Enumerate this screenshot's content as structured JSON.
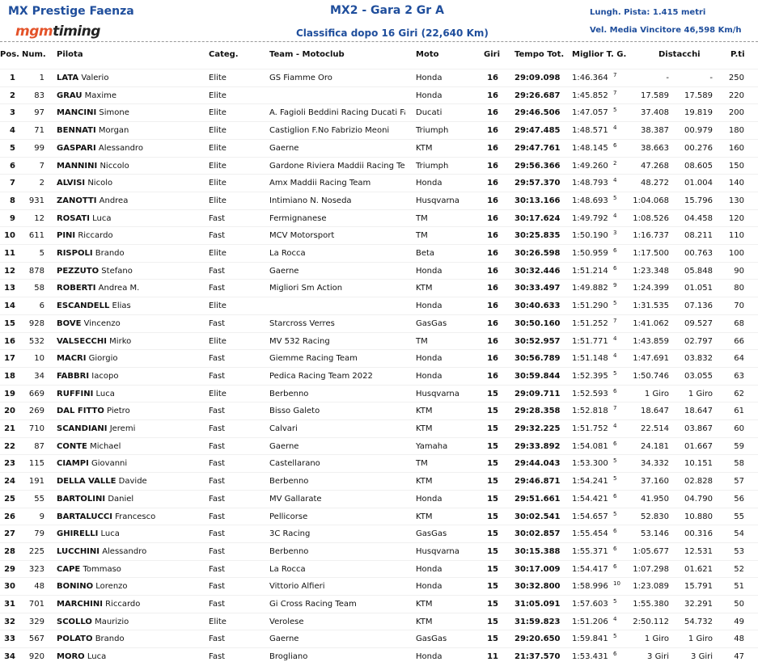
{
  "header": {
    "event": "MX Prestige Faenza",
    "logo_a": "mgm",
    "logo_b": "timing",
    "race": "MX2 - Gara 2 Gr A",
    "classification": "Classifica dopo 16 Giri (22,640 Km)",
    "track_length": "Lungh. Pista: 1.415 metri",
    "winner_speed": "Vel. Media Vincitore 46,598 Km/h"
  },
  "columns": {
    "pos": "Pos.",
    "num": "Num.",
    "pilota": "Pilota",
    "categ": "Categ.",
    "team": "Team - Motoclub",
    "moto": "Moto",
    "giri": "Giri",
    "tempo": "Tempo Tot.",
    "miglior": "Miglior T. G.",
    "distacchi": "Distacchi",
    "pti": "P.ti"
  },
  "rows": [
    {
      "pos": "1",
      "num": "1",
      "last": "LATA",
      "first": "Valerio",
      "cat": "Elite",
      "team": "GS Fiamme Oro",
      "moto": "Honda",
      "giri": "16",
      "tempo": "29:09.098",
      "best": "1:46.364",
      "lap": "7",
      "d1": "-",
      "d2": "-",
      "pt": "250"
    },
    {
      "pos": "2",
      "num": "83",
      "last": "GRAU",
      "first": "Maxime",
      "cat": "Elite",
      "team": "",
      "moto": "Honda",
      "giri": "16",
      "tempo": "29:26.687",
      "best": "1:45.852",
      "lap": "7",
      "d1": "17.589",
      "d2": "17.589",
      "pt": "220"
    },
    {
      "pos": "3",
      "num": "97",
      "last": "MANCINI",
      "first": "Simone",
      "cat": "Elite",
      "team": "A. Fagioli Beddini Racing Ducati Fa",
      "moto": "Ducati",
      "giri": "16",
      "tempo": "29:46.506",
      "best": "1:47.057",
      "lap": "5",
      "d1": "37.408",
      "d2": "19.819",
      "pt": "200"
    },
    {
      "pos": "4",
      "num": "71",
      "last": "BENNATI",
      "first": "Morgan",
      "cat": "Elite",
      "team": "Castiglion F.No Fabrizio Meoni",
      "moto": "Triumph",
      "giri": "16",
      "tempo": "29:47.485",
      "best": "1:48.571",
      "lap": "4",
      "d1": "38.387",
      "d2": "00.979",
      "pt": "180"
    },
    {
      "pos": "5",
      "num": "99",
      "last": "GASPARI",
      "first": "Alessandro",
      "cat": "Elite",
      "team": "Gaerne",
      "moto": "KTM",
      "giri": "16",
      "tempo": "29:47.761",
      "best": "1:48.145",
      "lap": "6",
      "d1": "38.663",
      "d2": "00.276",
      "pt": "160"
    },
    {
      "pos": "6",
      "num": "7",
      "last": "MANNINI",
      "first": "Niccolo",
      "cat": "Elite",
      "team": "Gardone Riviera Maddii Racing Te",
      "moto": "Triumph",
      "giri": "16",
      "tempo": "29:56.366",
      "best": "1:49.260",
      "lap": "2",
      "d1": "47.268",
      "d2": "08.605",
      "pt": "150"
    },
    {
      "pos": "7",
      "num": "2",
      "last": "ALVISI",
      "first": "Nicolo",
      "cat": "Elite",
      "team": "Amx Maddii Racing Team",
      "moto": "Honda",
      "giri": "16",
      "tempo": "29:57.370",
      "best": "1:48.793",
      "lap": "4",
      "d1": "48.272",
      "d2": "01.004",
      "pt": "140"
    },
    {
      "pos": "8",
      "num": "931",
      "last": "ZANOTTI",
      "first": "Andrea",
      "cat": "Elite",
      "team": "Intimiano N. Noseda",
      "moto": "Husqvarna",
      "giri": "16",
      "tempo": "30:13.166",
      "best": "1:48.693",
      "lap": "5",
      "d1": "1:04.068",
      "d2": "15.796",
      "pt": "130"
    },
    {
      "pos": "9",
      "num": "12",
      "last": "ROSATI",
      "first": "Luca",
      "cat": "Fast",
      "team": "Fermignanese",
      "moto": "TM",
      "giri": "16",
      "tempo": "30:17.624",
      "best": "1:49.792",
      "lap": "4",
      "d1": "1:08.526",
      "d2": "04.458",
      "pt": "120"
    },
    {
      "pos": "10",
      "num": "611",
      "last": "PINI",
      "first": "Riccardo",
      "cat": "Fast",
      "team": "MCV Motorsport",
      "moto": "TM",
      "giri": "16",
      "tempo": "30:25.835",
      "best": "1:50.190",
      "lap": "3",
      "d1": "1:16.737",
      "d2": "08.211",
      "pt": "110"
    },
    {
      "pos": "11",
      "num": "5",
      "last": "RISPOLI",
      "first": "Brando",
      "cat": "Elite",
      "team": "La Rocca",
      "moto": "Beta",
      "giri": "16",
      "tempo": "30:26.598",
      "best": "1:50.959",
      "lap": "6",
      "d1": "1:17.500",
      "d2": "00.763",
      "pt": "100"
    },
    {
      "pos": "12",
      "num": "878",
      "last": "PEZZUTO",
      "first": "Stefano",
      "cat": "Fast",
      "team": "Gaerne",
      "moto": "Honda",
      "giri": "16",
      "tempo": "30:32.446",
      "best": "1:51.214",
      "lap": "6",
      "d1": "1:23.348",
      "d2": "05.848",
      "pt": "90"
    },
    {
      "pos": "13",
      "num": "58",
      "last": "ROBERTI",
      "first": "Andrea M.",
      "cat": "Fast",
      "team": "Migliori Sm Action",
      "moto": "KTM",
      "giri": "16",
      "tempo": "30:33.497",
      "best": "1:49.882",
      "lap": "9",
      "d1": "1:24.399",
      "d2": "01.051",
      "pt": "80"
    },
    {
      "pos": "14",
      "num": "6",
      "last": "ESCANDELL",
      "first": "Elias",
      "cat": "Elite",
      "team": "",
      "moto": "Honda",
      "giri": "16",
      "tempo": "30:40.633",
      "best": "1:51.290",
      "lap": "5",
      "d1": "1:31.535",
      "d2": "07.136",
      "pt": "70"
    },
    {
      "pos": "15",
      "num": "928",
      "last": "BOVE",
      "first": "Vincenzo",
      "cat": "Fast",
      "team": "Starcross Verres",
      "moto": "GasGas",
      "giri": "16",
      "tempo": "30:50.160",
      "best": "1:51.252",
      "lap": "7",
      "d1": "1:41.062",
      "d2": "09.527",
      "pt": "68"
    },
    {
      "pos": "16",
      "num": "532",
      "last": "VALSECCHI",
      "first": "Mirko",
      "cat": "Elite",
      "team": "MV 532 Racing",
      "moto": "TM",
      "giri": "16",
      "tempo": "30:52.957",
      "best": "1:51.771",
      "lap": "4",
      "d1": "1:43.859",
      "d2": "02.797",
      "pt": "66"
    },
    {
      "pos": "17",
      "num": "10",
      "last": "MACRI",
      "first": "Giorgio",
      "cat": "Fast",
      "team": "Giemme Racing Team",
      "moto": "Honda",
      "giri": "16",
      "tempo": "30:56.789",
      "best": "1:51.148",
      "lap": "4",
      "d1": "1:47.691",
      "d2": "03.832",
      "pt": "64"
    },
    {
      "pos": "18",
      "num": "34",
      "last": "FABBRI",
      "first": "Iacopo",
      "cat": "Fast",
      "team": "Pedica Racing Team 2022",
      "moto": "Honda",
      "giri": "16",
      "tempo": "30:59.844",
      "best": "1:52.395",
      "lap": "5",
      "d1": "1:50.746",
      "d2": "03.055",
      "pt": "63"
    },
    {
      "pos": "19",
      "num": "669",
      "last": "RUFFINI",
      "first": "Luca",
      "cat": "Elite",
      "team": "Berbenno",
      "moto": "Husqvarna",
      "giri": "15",
      "tempo": "29:09.711",
      "best": "1:52.593",
      "lap": "6",
      "d1": "1 Giro",
      "d2": "1 Giro",
      "pt": "62"
    },
    {
      "pos": "20",
      "num": "269",
      "last": "DAL FITTO",
      "first": "Pietro",
      "cat": "Fast",
      "team": "Bisso Galeto",
      "moto": "KTM",
      "giri": "15",
      "tempo": "29:28.358",
      "best": "1:52.818",
      "lap": "7",
      "d1": "18.647",
      "d2": "18.647",
      "pt": "61"
    },
    {
      "pos": "21",
      "num": "710",
      "last": "SCANDIANI",
      "first": "Jeremi",
      "cat": "Fast",
      "team": "Calvari",
      "moto": "KTM",
      "giri": "15",
      "tempo": "29:32.225",
      "best": "1:51.752",
      "lap": "4",
      "d1": "22.514",
      "d2": "03.867",
      "pt": "60"
    },
    {
      "pos": "22",
      "num": "87",
      "last": "CONTE",
      "first": "Michael",
      "cat": "Fast",
      "team": "Gaerne",
      "moto": "Yamaha",
      "giri": "15",
      "tempo": "29:33.892",
      "best": "1:54.081",
      "lap": "6",
      "d1": "24.181",
      "d2": "01.667",
      "pt": "59"
    },
    {
      "pos": "23",
      "num": "115",
      "last": "CIAMPI",
      "first": "Giovanni",
      "cat": "Fast",
      "team": "Castellarano",
      "moto": "TM",
      "giri": "15",
      "tempo": "29:44.043",
      "best": "1:53.300",
      "lap": "5",
      "d1": "34.332",
      "d2": "10.151",
      "pt": "58"
    },
    {
      "pos": "24",
      "num": "191",
      "last": "DELLA VALLE",
      "first": "Davide",
      "cat": "Fast",
      "team": "Berbenno",
      "moto": "KTM",
      "giri": "15",
      "tempo": "29:46.871",
      "best": "1:54.241",
      "lap": "5",
      "d1": "37.160",
      "d2": "02.828",
      "pt": "57"
    },
    {
      "pos": "25",
      "num": "55",
      "last": "BARTOLINI",
      "first": "Daniel",
      "cat": "Fast",
      "team": "MV Gallarate",
      "moto": "Honda",
      "giri": "15",
      "tempo": "29:51.661",
      "best": "1:54.421",
      "lap": "6",
      "d1": "41.950",
      "d2": "04.790",
      "pt": "56"
    },
    {
      "pos": "26",
      "num": "9",
      "last": "BARTALUCCI",
      "first": "Francesco",
      "cat": "Fast",
      "team": "Pellicorse",
      "moto": "KTM",
      "giri": "15",
      "tempo": "30:02.541",
      "best": "1:54.657",
      "lap": "5",
      "d1": "52.830",
      "d2": "10.880",
      "pt": "55"
    },
    {
      "pos": "27",
      "num": "79",
      "last": "GHIRELLI",
      "first": "Luca",
      "cat": "Fast",
      "team": "3C Racing",
      "moto": "GasGas",
      "giri": "15",
      "tempo": "30:02.857",
      "best": "1:55.454",
      "lap": "6",
      "d1": "53.146",
      "d2": "00.316",
      "pt": "54"
    },
    {
      "pos": "28",
      "num": "225",
      "last": "LUCCHINI",
      "first": "Alessandro",
      "cat": "Fast",
      "team": "Berbenno",
      "moto": "Husqvarna",
      "giri": "15",
      "tempo": "30:15.388",
      "best": "1:55.371",
      "lap": "6",
      "d1": "1:05.677",
      "d2": "12.531",
      "pt": "53"
    },
    {
      "pos": "29",
      "num": "323",
      "last": "CAPE",
      "first": "Tommaso",
      "cat": "Fast",
      "team": "La Rocca",
      "moto": "Honda",
      "giri": "15",
      "tempo": "30:17.009",
      "best": "1:54.417",
      "lap": "6",
      "d1": "1:07.298",
      "d2": "01.621",
      "pt": "52"
    },
    {
      "pos": "30",
      "num": "48",
      "last": "BONINO",
      "first": "Lorenzo",
      "cat": "Fast",
      "team": "Vittorio Alfieri",
      "moto": "Honda",
      "giri": "15",
      "tempo": "30:32.800",
      "best": "1:58.996",
      "lap": "10",
      "d1": "1:23.089",
      "d2": "15.791",
      "pt": "51"
    },
    {
      "pos": "31",
      "num": "701",
      "last": "MARCHINI",
      "first": "Riccardo",
      "cat": "Fast",
      "team": "Gi Cross Racing Team",
      "moto": "KTM",
      "giri": "15",
      "tempo": "31:05.091",
      "best": "1:57.603",
      "lap": "5",
      "d1": "1:55.380",
      "d2": "32.291",
      "pt": "50"
    },
    {
      "pos": "32",
      "num": "329",
      "last": "SCOLLO",
      "first": "Maurizio",
      "cat": "Elite",
      "team": "Verolese",
      "moto": "KTM",
      "giri": "15",
      "tempo": "31:59.823",
      "best": "1:51.206",
      "lap": "4",
      "d1": "2:50.112",
      "d2": "54.732",
      "pt": "49"
    },
    {
      "pos": "33",
      "num": "567",
      "last": "POLATO",
      "first": "Brando",
      "cat": "Fast",
      "team": "Gaerne",
      "moto": "GasGas",
      "giri": "15",
      "tempo": "29:20.650",
      "best": "1:59.841",
      "lap": "5",
      "d1": "1 Giro",
      "d2": "1 Giro",
      "pt": "48"
    },
    {
      "pos": "34",
      "num": "920",
      "last": "MORO",
      "first": "Luca",
      "cat": "Fast",
      "team": "Brogliano",
      "moto": "Honda",
      "giri": "11",
      "tempo": "21:37.570",
      "best": "1:53.431",
      "lap": "6",
      "d1": "3 Giri",
      "d2": "3 Giri",
      "pt": "47"
    }
  ]
}
